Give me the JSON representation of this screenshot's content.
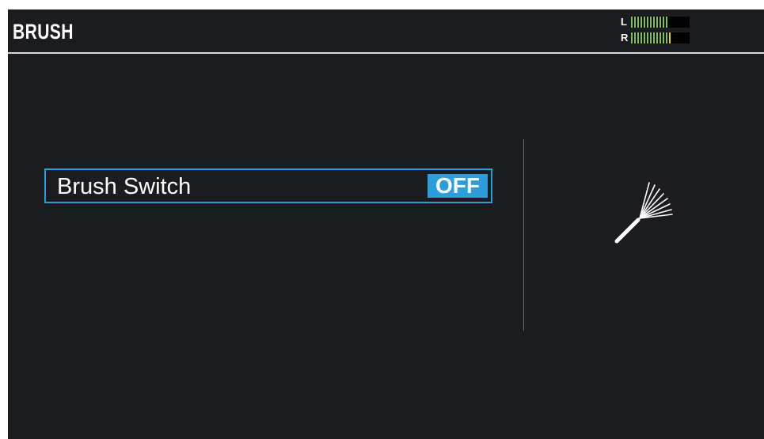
{
  "header": {
    "title": "BRUSH"
  },
  "meter": {
    "left_label": "L",
    "right_label": "R",
    "left_level": 0.67,
    "right_level": 0.72,
    "colors": {
      "green": "#7dc242",
      "yellow": "#f2c230",
      "off": "#000000"
    }
  },
  "parameter": {
    "label": "Brush Switch",
    "value": "OFF"
  },
  "icons": {
    "brush": "brush-icon"
  },
  "colors": {
    "accent": "#2a9ed8",
    "background": "#1a1c20",
    "text": "#ffffff"
  }
}
